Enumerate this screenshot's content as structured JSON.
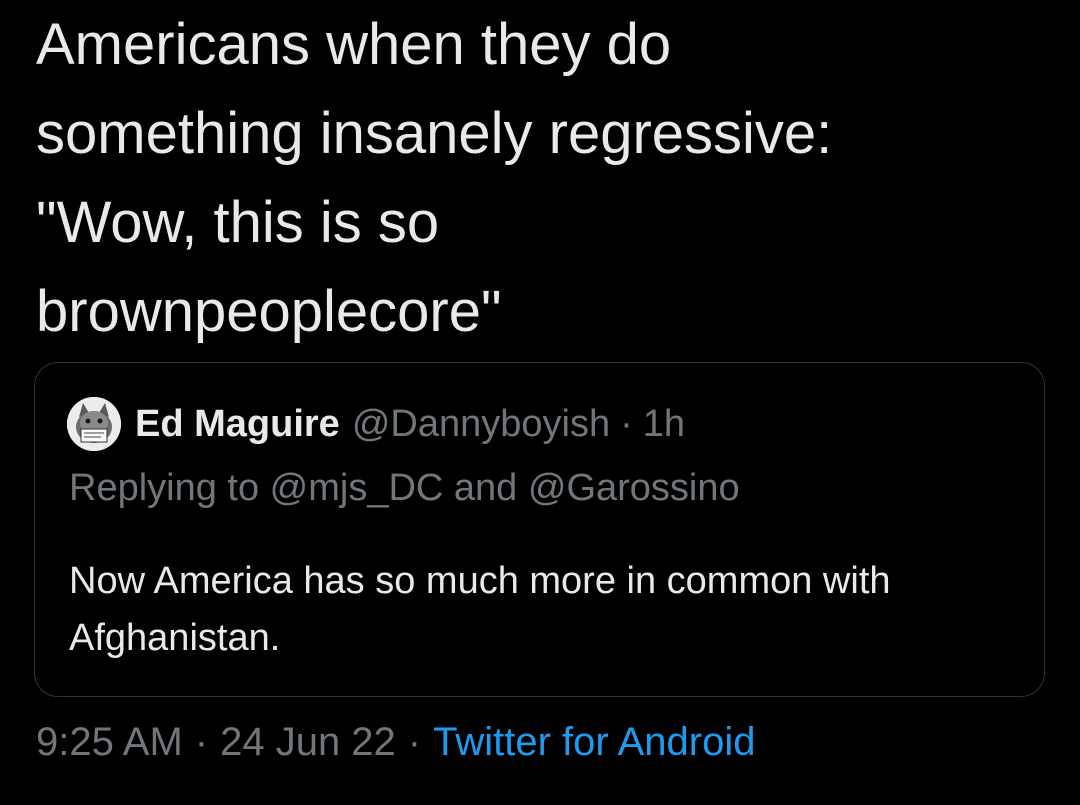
{
  "tweet": {
    "text": "Americans when they do\nsomething insanely regressive:\n\"Wow, this is so\nbrownpeoplecore\""
  },
  "quote": {
    "author_name": "Ed Maguire",
    "author_handle": "@Dannyboyish",
    "separator": "·",
    "time": "1h",
    "replying_to_text": "Replying to @mjs_DC and @Garossino",
    "body": "Now America has so much more in common with Afghanistan.",
    "avatar_icon": "cat-avatar-icon"
  },
  "meta": {
    "time": "9:25 AM",
    "separator": "·",
    "date": "24 Jun 22",
    "source": "Twitter for Android"
  },
  "colors": {
    "background": "#000000",
    "text": "#e7e9ea",
    "muted": "#71767b",
    "link": "#1d9bf0",
    "border": "#2f3336"
  }
}
